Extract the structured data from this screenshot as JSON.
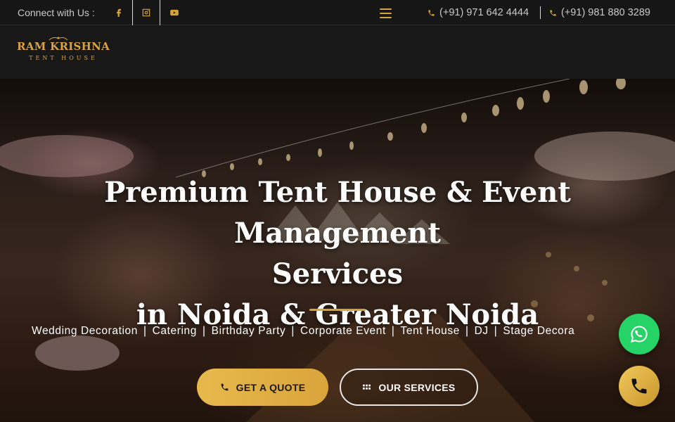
{
  "topbar": {
    "connect_label": "Connect with Us :",
    "socials": [
      {
        "icon": "facebook-icon"
      },
      {
        "icon": "instagram-icon"
      },
      {
        "icon": "youtube-icon"
      }
    ],
    "phones": [
      "(+91) 971 642 4444",
      "(+91) 981 880 3289"
    ]
  },
  "logo": {
    "main": "RAM KRISHNA",
    "sub": "TENT HOUSE"
  },
  "hero": {
    "title_line1": "Premium Tent House & Event Management",
    "title_line2": "Services",
    "title_line3": "in Noida & Greater Noida",
    "services": [
      "Wedding Decoration",
      "Catering",
      "Birthday Party",
      "Corporate Event",
      "Tent House",
      "DJ",
      "Stage Decora"
    ],
    "separator": "|",
    "cta_quote": "GET A QUOTE",
    "cta_services": "OUR SERVICES"
  },
  "colors": {
    "accent": "#d4a43a",
    "whatsapp": "#25d366"
  }
}
